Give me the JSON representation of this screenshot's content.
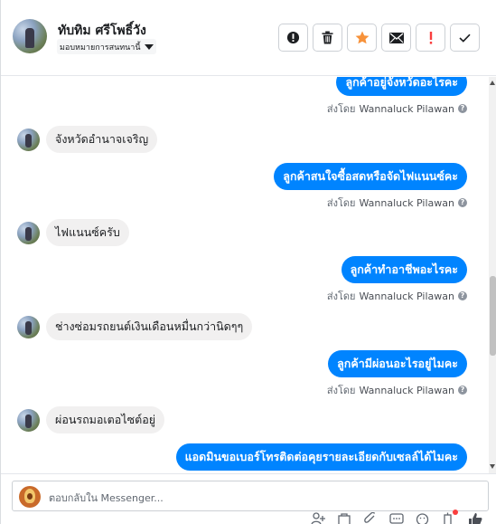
{
  "header": {
    "contact_name": "ทับทิม ศรีโพธิ์วัง",
    "assign_label": "มอบหมายการสนทนานี้"
  },
  "actions": [
    {
      "name": "follow-up-button",
      "icon": "exclamation-circle-icon"
    },
    {
      "name": "delete-button",
      "icon": "trash-icon"
    },
    {
      "name": "star-button",
      "icon": "star-icon",
      "color": "#f7923a"
    },
    {
      "name": "mark-unread-button",
      "icon": "envelope-icon"
    },
    {
      "name": "mark-spam-button",
      "icon": "exclamation-icon",
      "color": "#fa3e3e"
    },
    {
      "name": "mark-done-button",
      "icon": "checkmark-icon"
    }
  ],
  "messages": [
    {
      "dir": "out",
      "text": "ลูกค้าอยู่จังหวัดอะไรคะ",
      "sent_by_label": "ส่งโดย",
      "sender": "Wannaluck Pilawan"
    },
    {
      "dir": "in",
      "text": "จังหวัดอำนาจเจริญ"
    },
    {
      "dir": "out",
      "text": "ลูกค้าสนใจซื้อสดหรือจัดไฟแนนซ์คะ",
      "sent_by_label": "ส่งโดย",
      "sender": "Wannaluck Pilawan"
    },
    {
      "dir": "in",
      "text": "ไฟแนนซ์ครับ"
    },
    {
      "dir": "out",
      "text": "ลูกค้าทำอาชีพอะไรคะ",
      "sent_by_label": "ส่งโดย",
      "sender": "Wannaluck Pilawan"
    },
    {
      "dir": "in",
      "text": "ช่างซ่อมรถยนต์เงินเดือนหมื่นกว่านิดๆๆ"
    },
    {
      "dir": "out",
      "text": "ลูกค้ามีผ่อนอะไรอยู่ไมคะ",
      "sent_by_label": "ส่งโดย",
      "sender": "Wannaluck Pilawan"
    },
    {
      "dir": "in",
      "text": "ผ่อนรถมอเตอไซต์อยู่"
    },
    {
      "dir": "out",
      "text": "แอดมินขอเบอร์โทรติดต่อคุยรายละเอียดกับเซลล์ได้ไมคะ"
    }
  ],
  "composer": {
    "placeholder": "ตอบกลับใน Messenger..."
  },
  "colors": {
    "outgoing_bubble": "#0084ff",
    "incoming_bubble": "#f1f0f0"
  }
}
